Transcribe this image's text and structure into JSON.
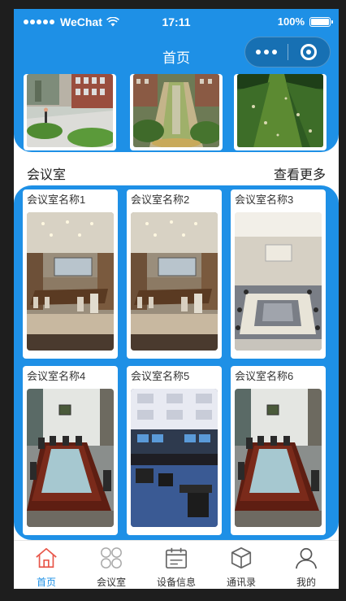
{
  "status_bar": {
    "carrier": "WeChat",
    "time": "17:11",
    "battery": "100%"
  },
  "nav": {
    "title": "首页"
  },
  "top_strip": {
    "images": [
      {
        "subject": "campus-plaza-photo"
      },
      {
        "subject": "campus-garden-photo"
      },
      {
        "subject": "campus-lawn-photo"
      }
    ]
  },
  "section": {
    "title": "会议室",
    "more_label": "查看更多"
  },
  "rooms": [
    {
      "name": "会议室名称1",
      "photo": "boardroom-wood-table"
    },
    {
      "name": "会议室名称2",
      "photo": "boardroom-wood-table"
    },
    {
      "name": "会议室名称3",
      "photo": "conference-room-u-table"
    },
    {
      "name": "会议室名称4",
      "photo": "boardroom-long-mahogany-table"
    },
    {
      "name": "会议室名称5",
      "photo": "control-room-monitors"
    },
    {
      "name": "会议室名称6",
      "photo": "boardroom-long-mahogany-table"
    }
  ],
  "tabs": [
    {
      "label": "首页",
      "icon": "home-icon",
      "active": true
    },
    {
      "label": "会议室",
      "icon": "clover-icon",
      "active": false
    },
    {
      "label": "设备信息",
      "icon": "calendar-icon",
      "active": false
    },
    {
      "label": "通讯录",
      "icon": "cube-icon",
      "active": false
    },
    {
      "label": "我的",
      "icon": "user-icon",
      "active": false
    }
  ],
  "colors": {
    "accent": "#1e90e6",
    "active_tab_icon": "#e8574a"
  }
}
